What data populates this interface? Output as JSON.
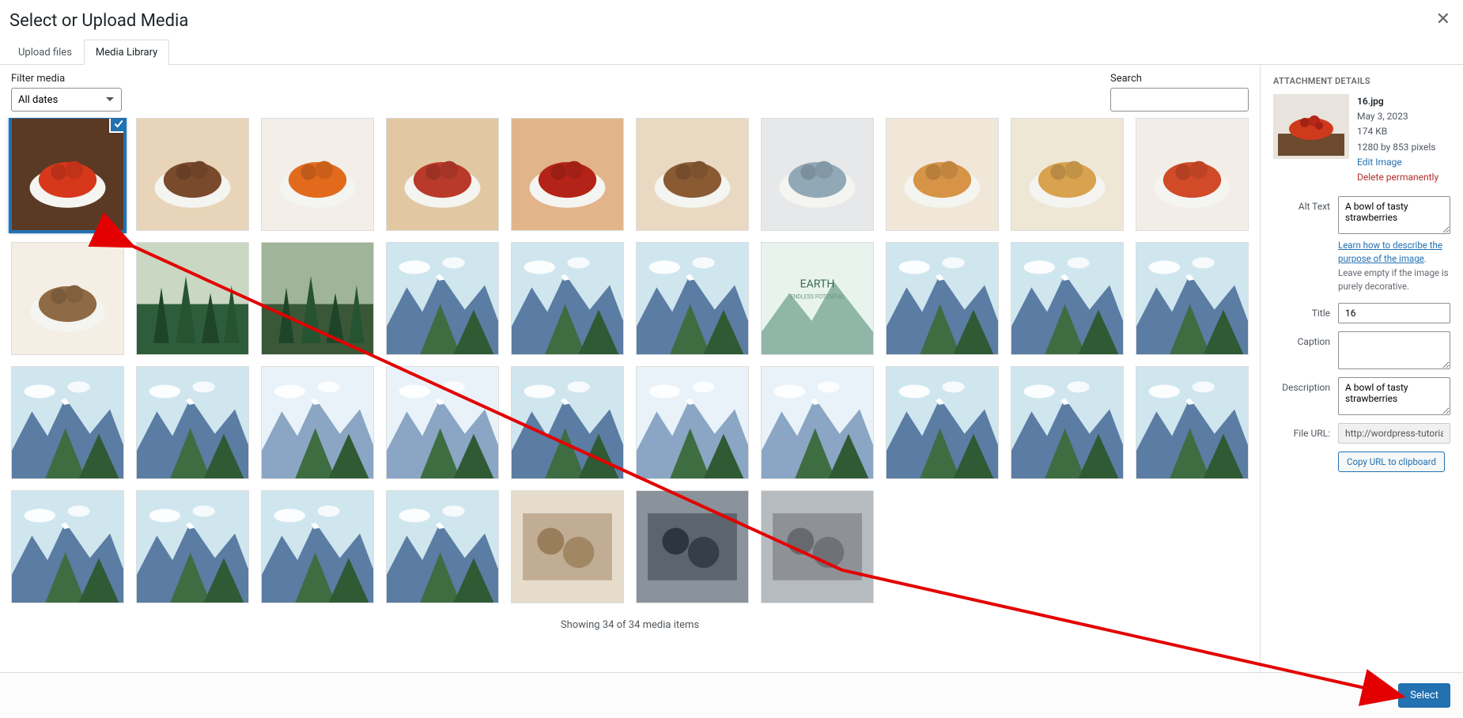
{
  "modal": {
    "title": "Select or Upload Media",
    "tabs": {
      "upload": "Upload files",
      "library": "Media Library"
    }
  },
  "filter": {
    "label": "Filter media",
    "selected": "All dates"
  },
  "search": {
    "label": "Search",
    "value": ""
  },
  "status_line": "Showing 34 of 34 media items",
  "sidebar": {
    "heading": "ATTACHMENT DETAILS",
    "filename": "16.jpg",
    "date": "May 3, 2023",
    "size": "174 KB",
    "dimensions": "1280 by 853 pixels",
    "edit_label": "Edit Image",
    "delete_label": "Delete permanently",
    "alt_label": "Alt Text",
    "alt_value": "A bowl of tasty strawberries",
    "alt_help_link": "Learn how to describe the purpose of the image",
    "alt_help_rest": ". Leave empty if the image is purely decorative.",
    "title_label": "Title",
    "title_value": "16",
    "caption_label": "Caption",
    "caption_value": "",
    "desc_label": "Description",
    "desc_value": "A bowl of tasty strawberries",
    "url_label": "File URL:",
    "url_value": "http://wordpress-tutorials.a",
    "copy_label": "Copy URL to clipboard"
  },
  "footer": {
    "select_label": "Select"
  },
  "thumbs": [
    {
      "kind": "food",
      "c1": "#d7381b",
      "c2": "#5a3a24",
      "sel": true
    },
    {
      "kind": "food",
      "c1": "#7a4a2c",
      "c2": "#e8d4b8"
    },
    {
      "kind": "food",
      "c1": "#e26a1d",
      "c2": "#f3eee7"
    },
    {
      "kind": "food",
      "c1": "#b93a2a",
      "c2": "#e1c8a2"
    },
    {
      "kind": "food",
      "c1": "#b42318",
      "c2": "#e1b48a"
    },
    {
      "kind": "food",
      "c1": "#8a5a33",
      "c2": "#ead9c2"
    },
    {
      "kind": "food",
      "c1": "#91a9b6",
      "c2": "#e6e8ea"
    },
    {
      "kind": "food",
      "c1": "#d79447",
      "c2": "#f1e7d8"
    },
    {
      "kind": "food",
      "c1": "#d8a24f",
      "c2": "#efe7d6"
    },
    {
      "kind": "food",
      "c1": "#d14b28",
      "c2": "#f2eee7"
    },
    {
      "kind": "food",
      "c1": "#8f6b45",
      "c2": "#f4eee4"
    },
    {
      "kind": "forest",
      "c1": "#2d5d3a",
      "c2": "#c9d7c3"
    },
    {
      "kind": "forest",
      "c1": "#3a5837",
      "c2": "#9fb498"
    },
    {
      "kind": "mtn",
      "c1": "#5b7ca3",
      "c2": "#cfe6ef"
    },
    {
      "kind": "mtn",
      "c1": "#5b7ca3",
      "c2": "#cfe6ef"
    },
    {
      "kind": "mtn",
      "c1": "#5b7ca3",
      "c2": "#cfe6ef"
    },
    {
      "kind": "earth",
      "c1": "#8fb6a7",
      "c2": "#e9f3ee"
    },
    {
      "kind": "mtn",
      "c1": "#5b7ca3",
      "c2": "#cfe6ef"
    },
    {
      "kind": "mtn",
      "c1": "#5b7ca3",
      "c2": "#cfe6ef"
    },
    {
      "kind": "mtn",
      "c1": "#5b7ca3",
      "c2": "#cfe6ef"
    },
    {
      "kind": "mtn",
      "c1": "#5b7ca3",
      "c2": "#cfe6ef"
    },
    {
      "kind": "mtn",
      "c1": "#5b7ca3",
      "c2": "#cfe6ef"
    },
    {
      "kind": "mtn",
      "c1": "#8aa6c4",
      "c2": "#e9f2f8"
    },
    {
      "kind": "mtn",
      "c1": "#8aa6c4",
      "c2": "#e9f2f8"
    },
    {
      "kind": "mtn",
      "c1": "#5b7ca3",
      "c2": "#cfe6ef"
    },
    {
      "kind": "mtn",
      "c1": "#8aa6c4",
      "c2": "#e9f2f8"
    },
    {
      "kind": "mtn",
      "c1": "#8aa6c4",
      "c2": "#e9f2f8"
    },
    {
      "kind": "mtn",
      "c1": "#5b7ca3",
      "c2": "#cfe6ef"
    },
    {
      "kind": "mtn",
      "c1": "#5b7ca3",
      "c2": "#cfe6ef"
    },
    {
      "kind": "mtn",
      "c1": "#5b7ca3",
      "c2": "#cfe6ef"
    },
    {
      "kind": "mtn",
      "c1": "#5b7ca3",
      "c2": "#cfe6ef"
    },
    {
      "kind": "mtn",
      "c1": "#5b7ca3",
      "c2": "#cfe6ef"
    },
    {
      "kind": "mtn",
      "c1": "#5b7ca3",
      "c2": "#cfe6ef"
    },
    {
      "kind": "mtn",
      "c1": "#5b7ca3",
      "c2": "#cfe6ef"
    },
    {
      "kind": "photo",
      "c1": "#9a7d5a",
      "c2": "#e6dccc"
    },
    {
      "kind": "photo",
      "c1": "#2d3640",
      "c2": "#8a939c"
    },
    {
      "kind": "photo",
      "c1": "#666a6e",
      "c2": "#b6bbc0"
    }
  ]
}
